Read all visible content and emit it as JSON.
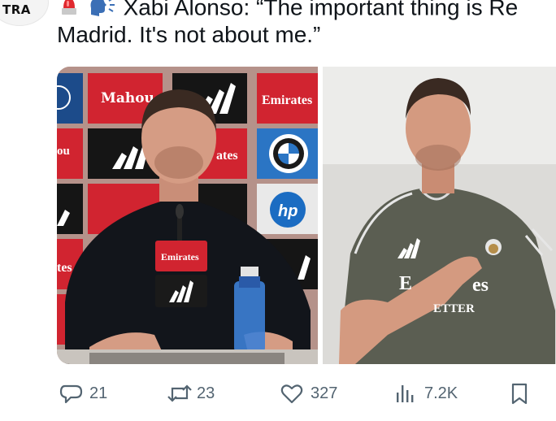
{
  "author": {
    "avatar_text": "TRA"
  },
  "tweet": {
    "line1": "Xabi Alonso: “The important thing is Re",
    "line2": "Madrid. It's not about me.”",
    "emojis": [
      "police-light",
      "speaking-head"
    ]
  },
  "media": {
    "left_image": {
      "board_labels": [
        "Mahou",
        "Emirates",
        "ates",
        "hp",
        "Emirates",
        "tes",
        "ou"
      ],
      "podium_label": "Emirates"
    },
    "right_image": {
      "shirt_text": "Emirates",
      "shirt_sub": "FLY BETTER",
      "shirt_visible_1": "E",
      "shirt_visible_2": "es",
      "shirt_visible_3": "ETTER"
    }
  },
  "actions": {
    "replies": "21",
    "reposts": "23",
    "likes": "327",
    "views": "7.2K"
  },
  "colors": {
    "text": "#0f1419",
    "muted": "#536471",
    "emirates_red": "#d71921",
    "shirt": "#5b5e52"
  }
}
